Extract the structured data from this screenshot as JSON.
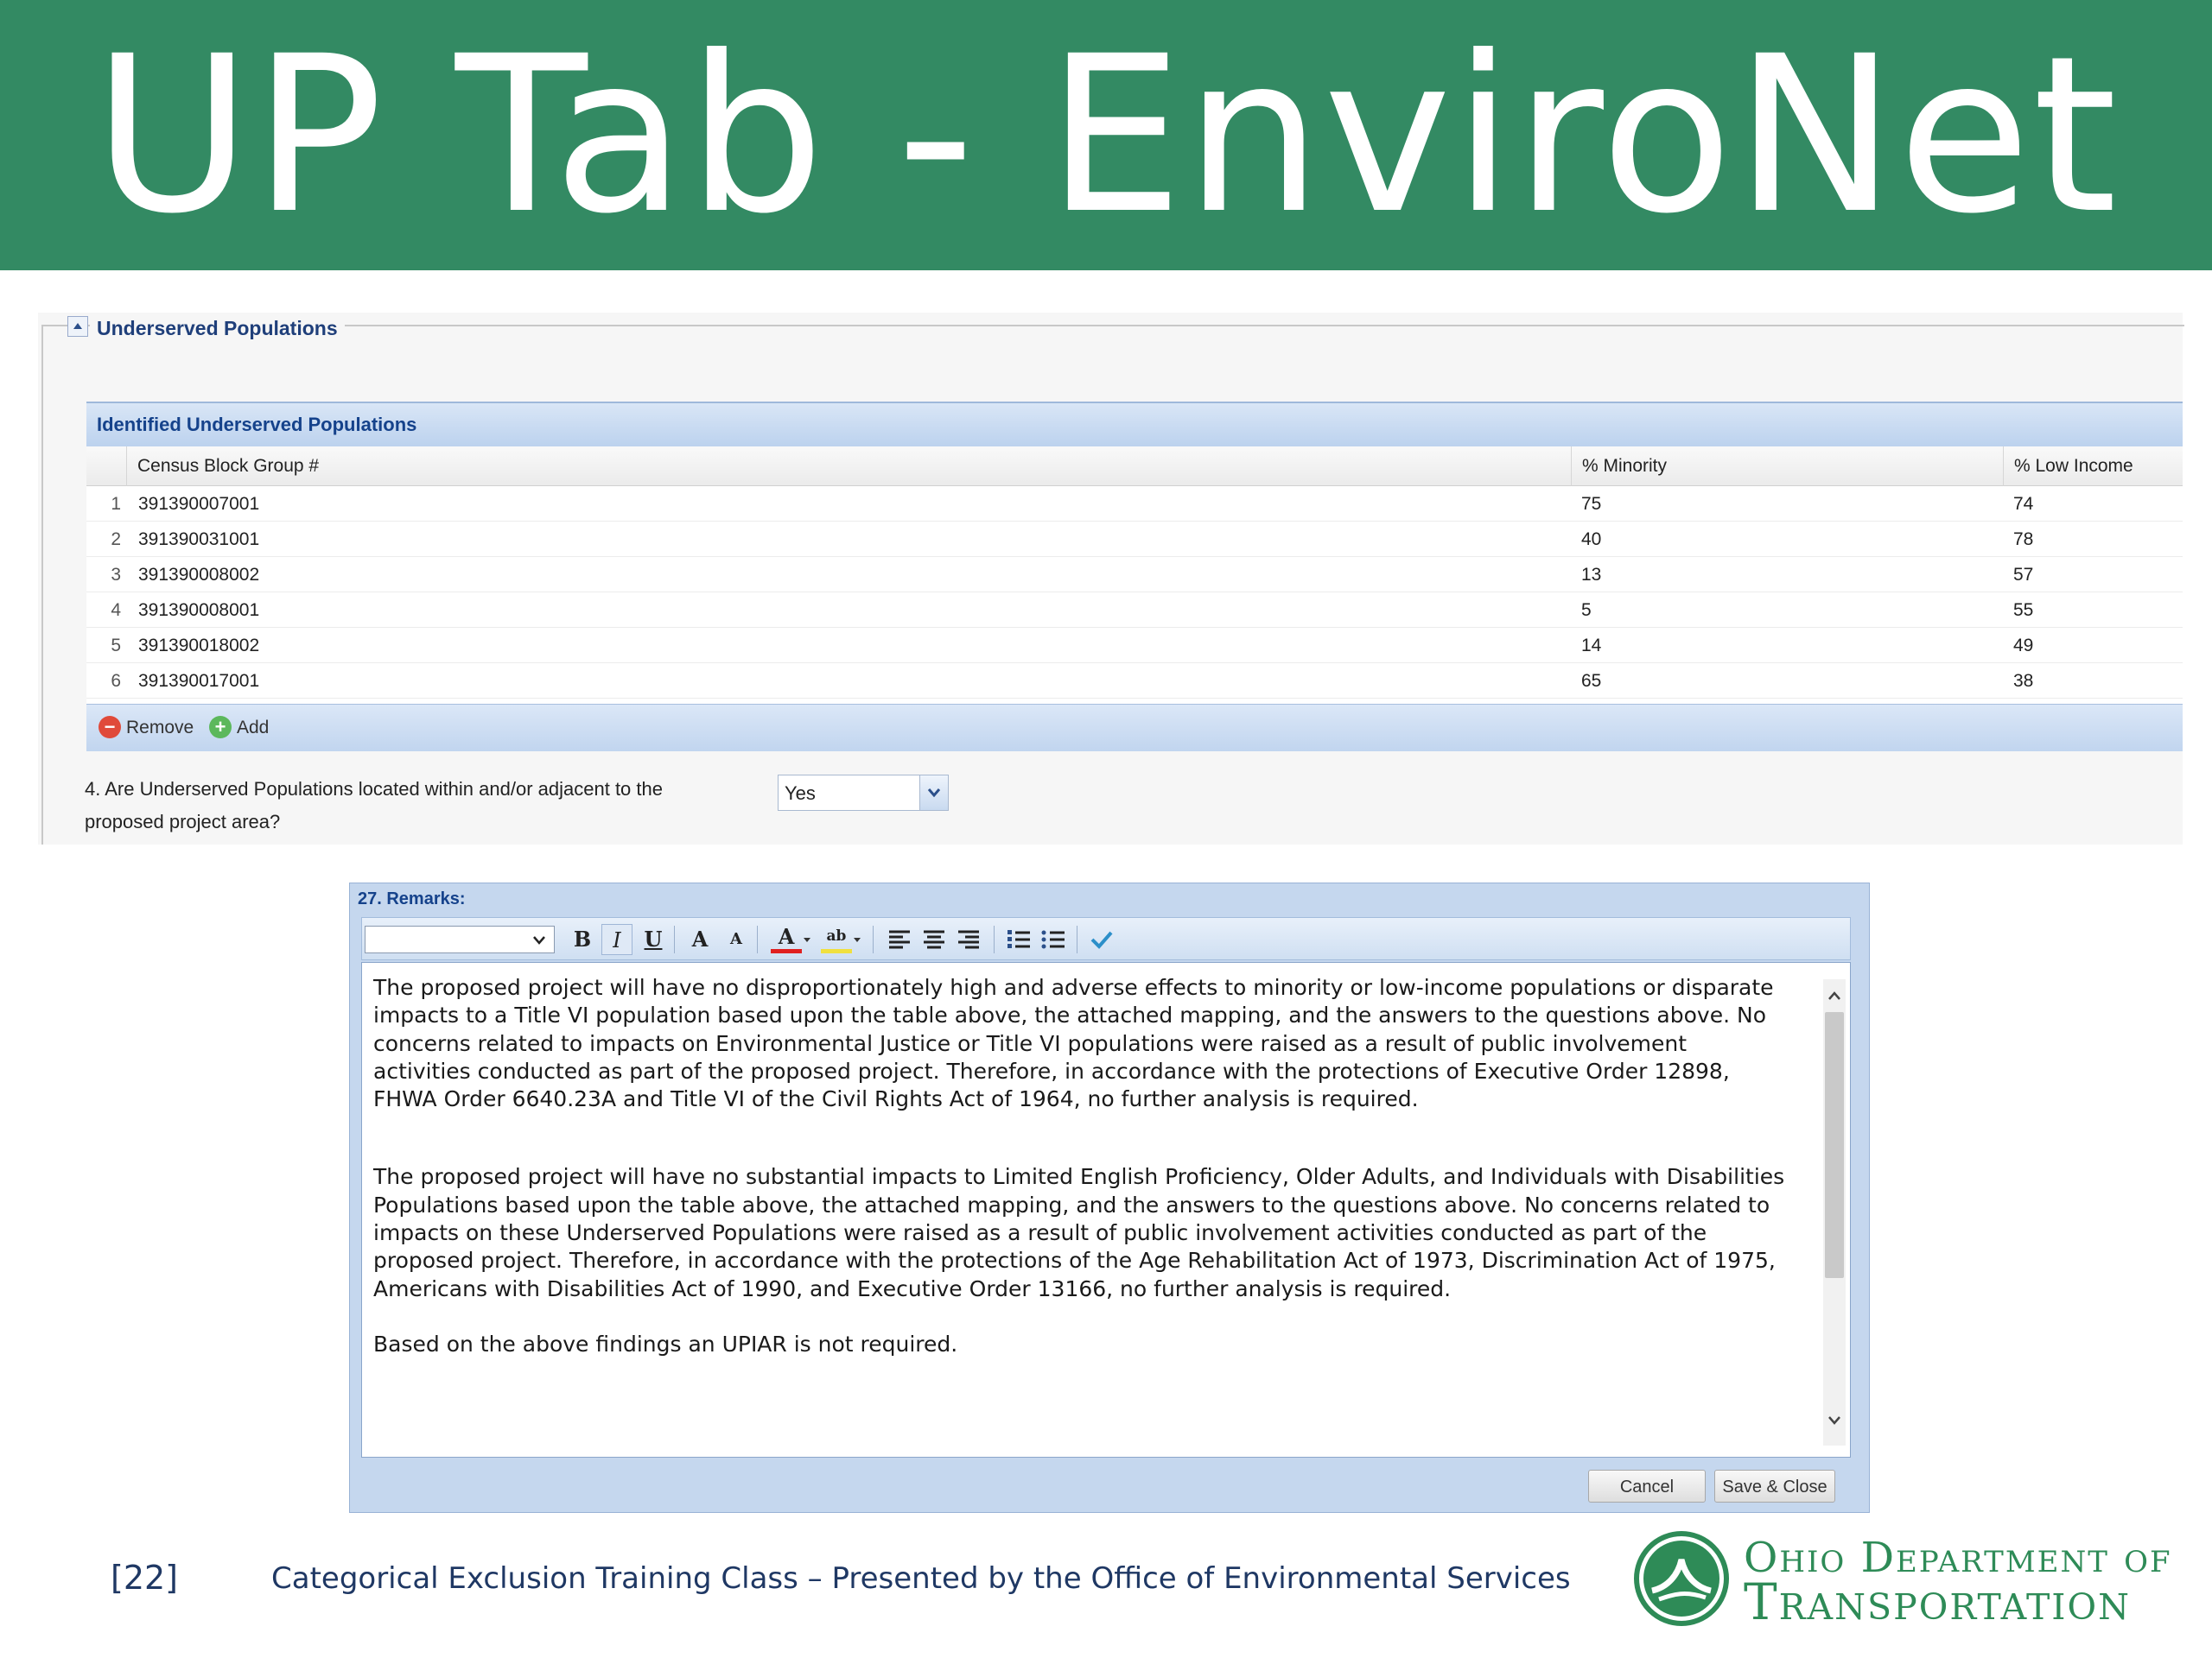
{
  "slide": {
    "title": "UP Tab - EnviroNet",
    "page_number": "[22]",
    "footer_text": "Categorical Exclusion Training Class – Presented by the Office of Environmental Services",
    "logo_line1": "Ohio Department of",
    "logo_line2": "Transportation"
  },
  "section": {
    "title": "Underserved Populations"
  },
  "grid": {
    "title": "Identified Underserved Populations",
    "columns": [
      "Census Block Group #",
      "% Minority",
      "% Low Income"
    ],
    "rows": [
      {
        "num": "1",
        "block": "391390007001",
        "minority": "75",
        "low_income": "74"
      },
      {
        "num": "2",
        "block": "391390031001",
        "minority": "40",
        "low_income": "78"
      },
      {
        "num": "3",
        "block": "391390008002",
        "minority": "13",
        "low_income": "57"
      },
      {
        "num": "4",
        "block": "391390008001",
        "minority": "5",
        "low_income": "55"
      },
      {
        "num": "5",
        "block": "391390018002",
        "minority": "14",
        "low_income": "49"
      },
      {
        "num": "6",
        "block": "391390017001",
        "minority": "65",
        "low_income": "38"
      }
    ],
    "remove_label": "Remove",
    "add_label": "Add"
  },
  "question": {
    "text": "4. Are Underserved Populations located within and/or adjacent to the proposed project area?",
    "selected_value": "Yes"
  },
  "remarks": {
    "title": "27. Remarks:",
    "font_value": "",
    "paragraph1": "The proposed project will have no disproportionately high and adverse effects to minority or low-income populations or disparate impacts to a Title VI population based upon the table above, the attached mapping, and the answers to the questions above. No concerns related to impacts on Environmental Justice or Title VI populations were raised as a result of public involvement activities conducted as part of the proposed project. Therefore, in accordance with the protections of Executive Order 12898, FHWA Order 6640.23A and Title VI of the Civil Rights Act of 1964, no further analysis is required.",
    "paragraph2": "The proposed project will have no substantial impacts to Limited English Proficiency, Older Adults, and Individuals with Disabilities Populations based upon the table above, the attached mapping, and the answers to the questions above. No concerns related to impacts on these Underserved Populations were raised as a result of public involvement activities conducted as part of the proposed project. Therefore, in accordance with the protections of the Age Rehabilitation Act of 1973, Discrimination Act of 1975, Americans with Disabilities Act of 1990, and Executive Order 13166, no further analysis is required.",
    "paragraph3": "Based on the above findings an UPIAR is not required.",
    "cancel_label": "Cancel",
    "save_label": "Save & Close"
  },
  "toolbar": {
    "bold": "B",
    "italic": "I",
    "underline": "U",
    "grow": "A",
    "shrink": "A",
    "font_color": "A",
    "highlight": "ab"
  },
  "colors": {
    "banner": "#338a63",
    "grid_header": "#c1d5ef",
    "accent_text": "#15428b",
    "footer_text": "#1f3864",
    "logo_green": "#2e8b57"
  }
}
